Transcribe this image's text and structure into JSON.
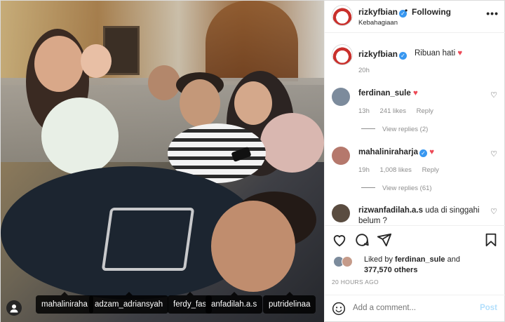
{
  "header": {
    "username": "rizkyfbian",
    "separator": "•",
    "follow_label": "Following",
    "location": "Kebahagiaan",
    "more_label": "•••"
  },
  "caption": {
    "username": "rizkyfbian",
    "text": "Ribuan hati",
    "heart": "♥",
    "time": "20h"
  },
  "comments": [
    {
      "username": "ferdinan_sule",
      "text": "",
      "heart": "♥",
      "time": "13h",
      "likes": "241 likes",
      "reply": "Reply",
      "view_replies": "View replies (2)"
    },
    {
      "username": "mahaliniraharja",
      "text": "",
      "heart": "♥",
      "time": "19h",
      "likes": "1,008 likes",
      "reply": "Reply",
      "view_replies": "View replies (61)"
    },
    {
      "username": "rizwanfadilah.a.s",
      "text": "uda di singgahi belum ?",
      "heart": "",
      "time": "",
      "likes": "",
      "reply": "",
      "view_replies": ""
    }
  ],
  "likes": {
    "prefix": "Liked by ",
    "user": "ferdinan_sule",
    "suffix": " and",
    "others": "377,570 others"
  },
  "time_ago": "20 HOURS AGO",
  "add_comment": {
    "placeholder": "Add a comment...",
    "post_label": "Post"
  },
  "photo_tags": [
    "mahaliniraha",
    "adzam_adriansyah",
    "ferdy_fas",
    "anfadilah.a.s",
    "putridelinaa"
  ],
  "colors": {
    "verified": "#3897f0",
    "heart": "#ed4956",
    "post": "#b2dffc"
  }
}
